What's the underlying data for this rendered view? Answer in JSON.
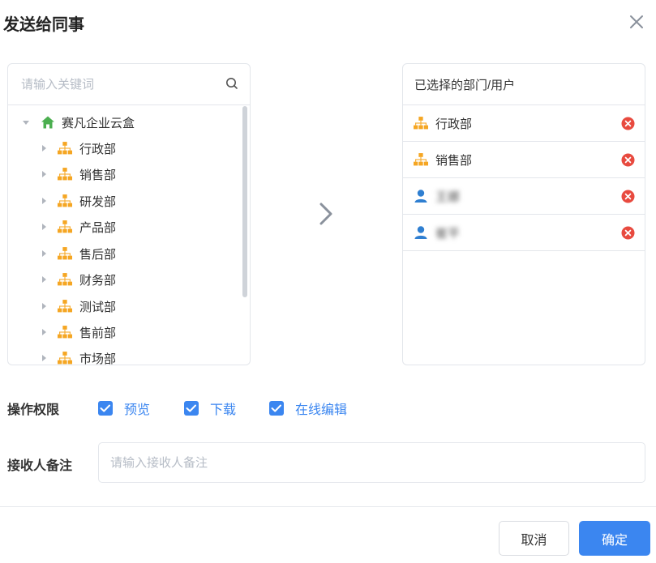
{
  "dialog": {
    "title": "发送给同事"
  },
  "search": {
    "placeholder": "请输入关键词"
  },
  "tree": {
    "root": "赛凡企业云盒",
    "items": [
      "行政部",
      "销售部",
      "研发部",
      "产品部",
      "售后部",
      "财务部",
      "测试部",
      "售前部",
      "市场部"
    ]
  },
  "selected": {
    "header": "已选择的部门/用户",
    "items": [
      {
        "type": "dept",
        "label": "行政部"
      },
      {
        "type": "dept",
        "label": "销售部"
      },
      {
        "type": "user",
        "label": "王娜"
      },
      {
        "type": "user",
        "label": "崔平"
      }
    ]
  },
  "permissions": {
    "label": "操作权限",
    "options": [
      {
        "label": "预览",
        "checked": true
      },
      {
        "label": "下载",
        "checked": true
      },
      {
        "label": "在线编辑",
        "checked": true
      }
    ]
  },
  "note": {
    "label": "接收人备注",
    "placeholder": "请输入接收人备注"
  },
  "buttons": {
    "cancel": "取消",
    "ok": "确定"
  },
  "colors": {
    "accent": "#3b86f0",
    "dept_icon": "#f5a623",
    "home_icon": "#4caf50",
    "remove": "#e84a3f"
  }
}
